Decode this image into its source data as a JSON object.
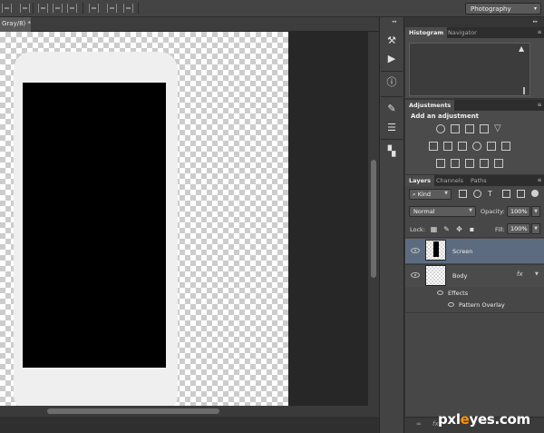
{
  "options_bar": {
    "workspace": "Photography"
  },
  "document": {
    "tab_title": "Gray/8) *"
  },
  "panels": {
    "top_tabs": [
      "Histogram",
      "Navigator"
    ],
    "adjustments": {
      "tab": "Adjustments",
      "title": "Add an adjustment"
    },
    "layers": {
      "tabs": [
        "Layers",
        "Channels",
        "Paths"
      ],
      "kind_filter": "Kind",
      "blend_mode": "Normal",
      "opacity_label": "Opacity:",
      "opacity_value": "100%",
      "lock_label": "Lock:",
      "fill_label": "Fill:",
      "fill_value": "100%",
      "items": [
        {
          "name": "Screen",
          "selected": true
        },
        {
          "name": "Body",
          "selected": false,
          "fx": "fx"
        }
      ],
      "effects_label": "Effects",
      "effect_item": "Pattern Overlay"
    }
  },
  "watermark": {
    "part1": "pxl",
    "part2": "e",
    "part3": "yes.com"
  },
  "colors": {
    "ui_dark": "#353535",
    "panel_bg": "#4b4b4b",
    "selected_layer": "#5d6b80",
    "screen_black": "#000000",
    "phone_body": "#efefef",
    "watermark_accent": "#ff9000"
  }
}
